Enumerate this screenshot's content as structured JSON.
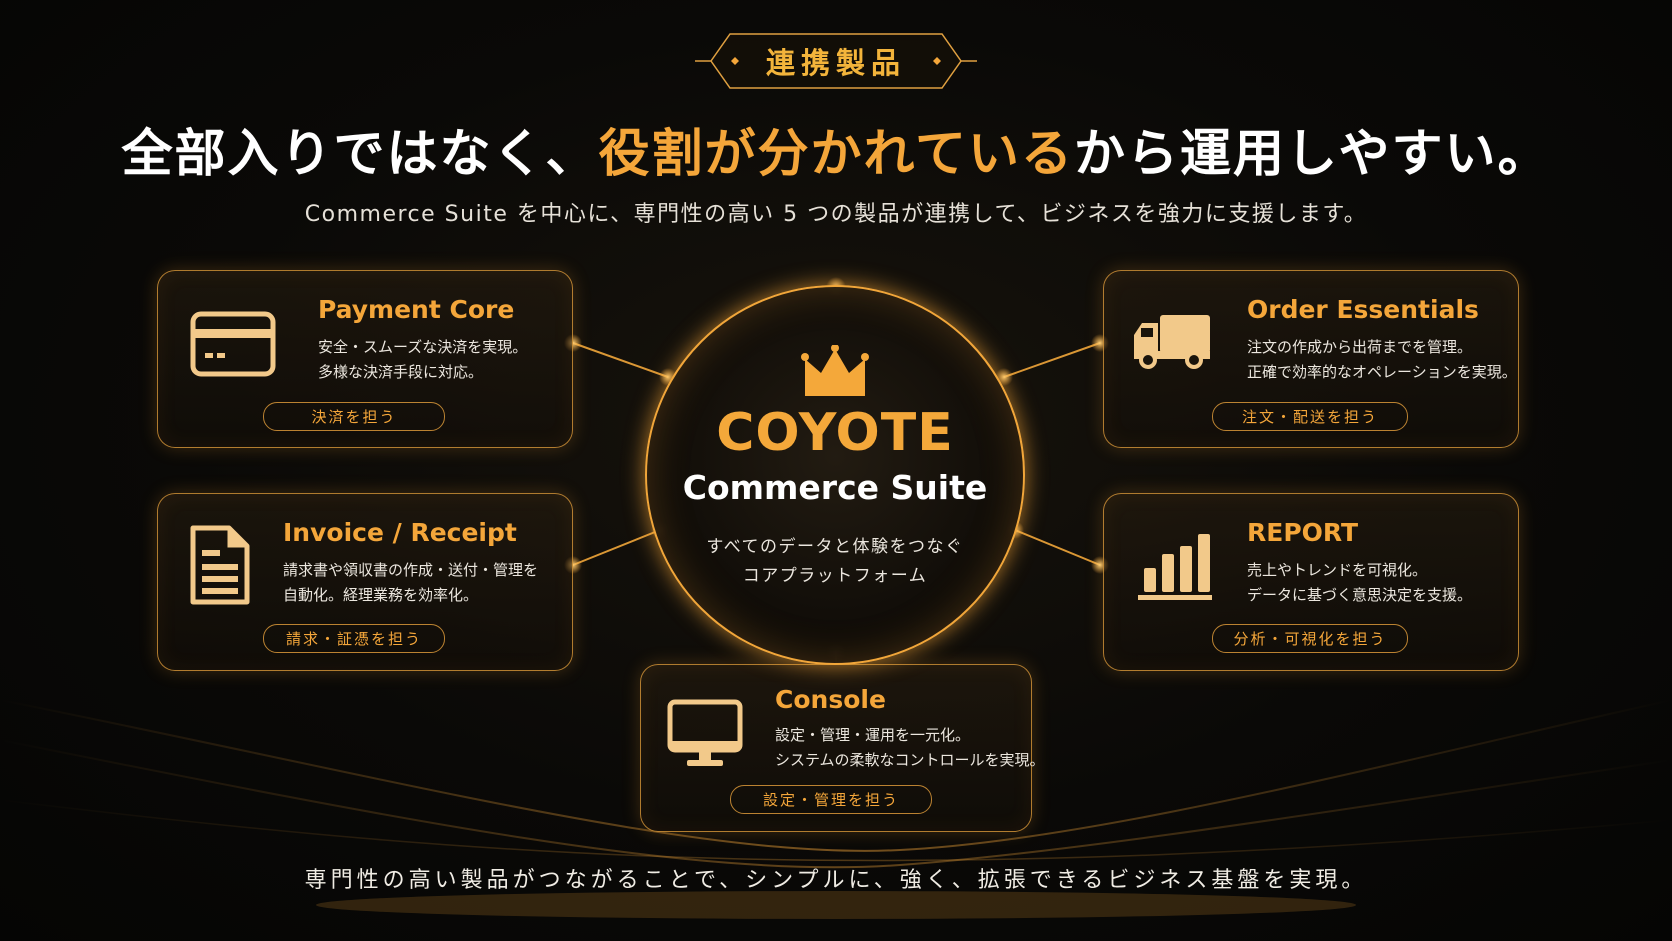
{
  "header": {
    "badge": "連携製品",
    "headline_pre": "全部入りではなく、",
    "headline_highlight": "役割が分かれている",
    "headline_post": "から運用しやすい。",
    "subline": "Commerce Suite を中心に、専門性の高い 5 つの製品が連携して、ビジネスを強力に支援します。"
  },
  "hub": {
    "brand": "COYOTE",
    "product": "Commerce Suite",
    "tagline_1": "すべてのデータと体験をつなぐ",
    "tagline_2": "コアプラットフォーム"
  },
  "products": [
    {
      "title": "Payment Core",
      "desc_1": "安全・スムーズな決済を実現。",
      "desc_2": "多様な決済手段に対応。",
      "role": "決済を担う",
      "icon": "credit-card-icon"
    },
    {
      "title": "Order Essentials",
      "desc_1": "注文の作成から出荷までを管理。",
      "desc_2": "正確で効率的なオペレーションを実現。",
      "role": "注文・配送を担う",
      "icon": "truck-icon"
    },
    {
      "title": "Invoice / Receipt",
      "desc_1": "請求書や領収書の作成・送付・管理を",
      "desc_2": "自動化。経理業務を効率化。",
      "role": "請求・証憑を担う",
      "icon": "document-icon"
    },
    {
      "title": "REPORT",
      "desc_1": "売上やトレンドを可視化。",
      "desc_2": "データに基づく意思決定を支援。",
      "role": "分析・可視化を担う",
      "icon": "bar-chart-icon"
    },
    {
      "title": "Console",
      "desc_1": "設定・管理・運用を一元化。",
      "desc_2": "システムの柔軟なコントロールを実現。",
      "role": "設定・管理を担う",
      "icon": "monitor-icon"
    }
  ],
  "footer": "専門性の高い製品がつながることで、シンプルに、強く、拡張できるビジネス基盤を実現。",
  "colors": {
    "accent": "#f4a63a",
    "background": "#0a0907",
    "text": "#ffffff"
  }
}
